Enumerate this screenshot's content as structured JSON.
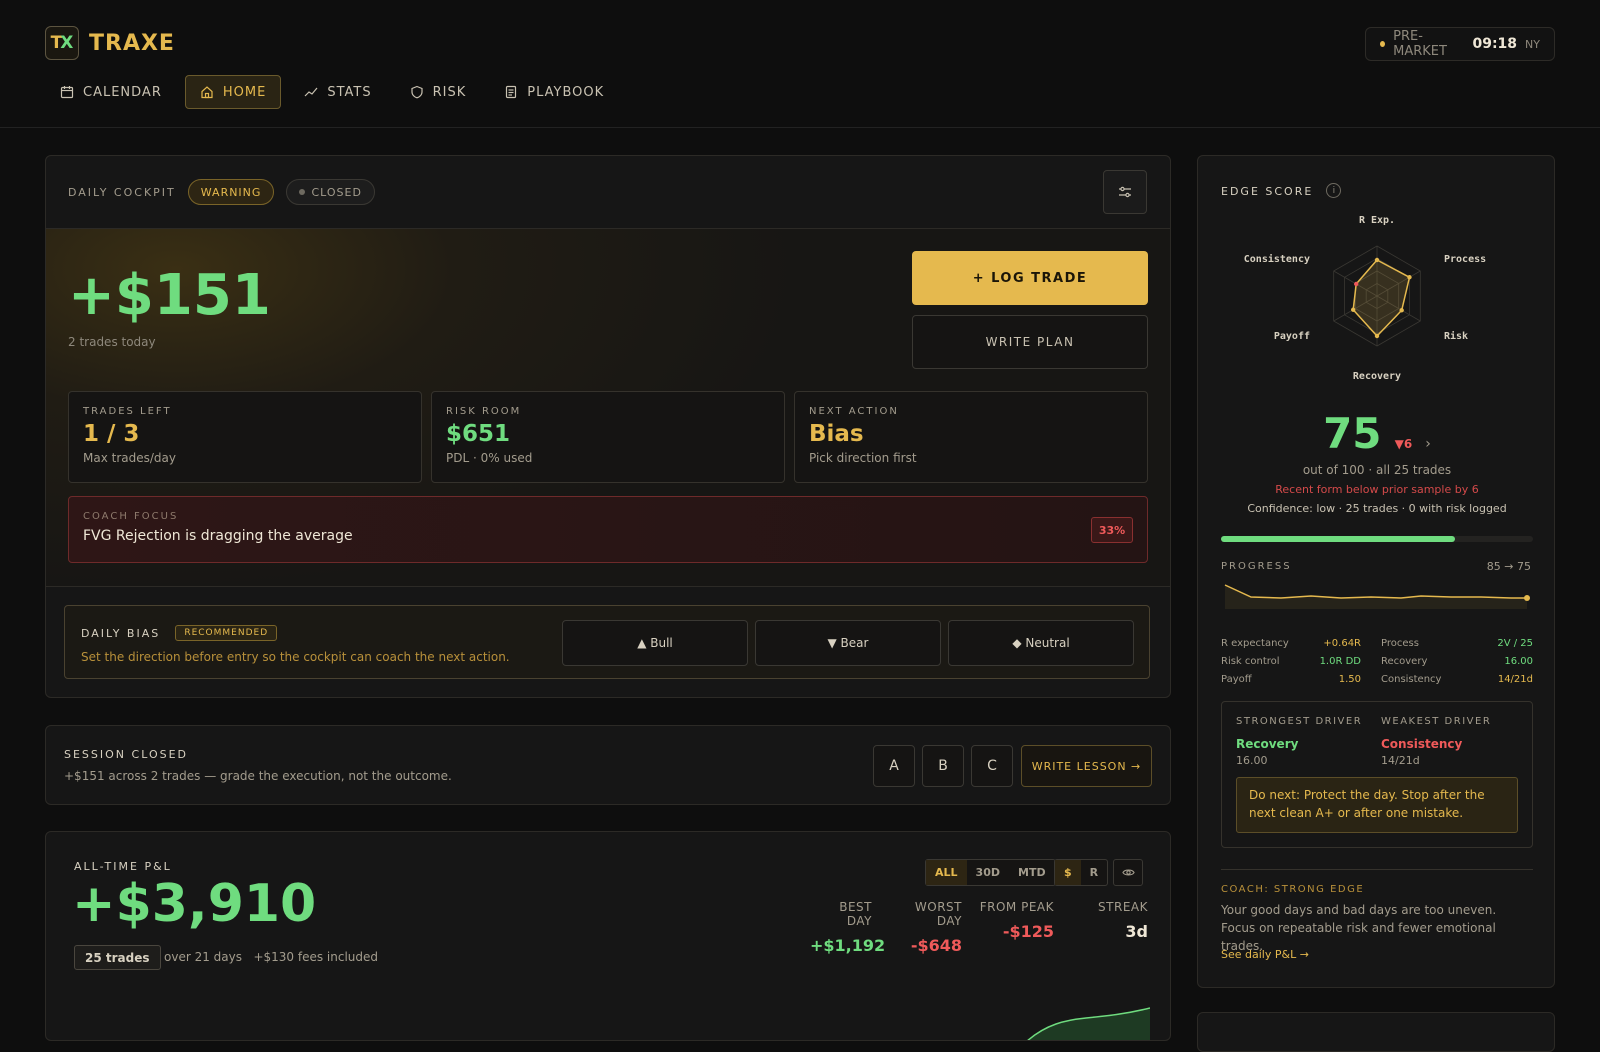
{
  "app": {
    "logo_mark_t": "T",
    "logo_mark_x": "X",
    "name": "TRAXE"
  },
  "clock": {
    "session": "PRE-MARKET",
    "time": "09:18",
    "tz": "NY"
  },
  "nav": [
    {
      "label": "CALENDAR",
      "icon": "calendar-icon",
      "active": false
    },
    {
      "label": "HOME",
      "icon": "home-icon",
      "active": true
    },
    {
      "label": "STATS",
      "icon": "trend-icon",
      "active": false
    },
    {
      "label": "RISK",
      "icon": "shield-icon",
      "active": false
    },
    {
      "label": "PLAYBOOK",
      "icon": "document-icon",
      "active": false
    }
  ],
  "cockpit": {
    "title": "DAILY COCKPIT",
    "status_warning": "WARNING",
    "status_closed": "CLOSED",
    "pnl": "+$151",
    "pnl_sub": "2 trades today",
    "log_trade": "+ LOG TRADE",
    "write_plan": "WRITE PLAN",
    "cards": [
      {
        "label": "TRADES LEFT",
        "value": "1 / 3",
        "sub": "Max trades/day"
      },
      {
        "label": "RISK ROOM",
        "value": "$651",
        "sub": "PDL · 0% used"
      },
      {
        "label": "NEXT ACTION",
        "value": "Bias",
        "sub": "Pick direction first"
      }
    ],
    "coach": {
      "label": "COACH FOCUS",
      "text": "FVG Rejection is dragging the average",
      "badge": "33%"
    },
    "bias": {
      "title": "DAILY BIAS",
      "badge": "RECOMMENDED",
      "desc": "Set the direction before entry so the cockpit can coach the next action.",
      "bull": "▲ Bull",
      "bear": "▼ Bear",
      "neutral": "◆ Neutral"
    }
  },
  "session": {
    "title": "SESSION CLOSED",
    "text": "+$151 across 2 trades — grade the execution, not the outcome.",
    "grades": [
      "A",
      "B",
      "C"
    ],
    "lesson": "WRITE LESSON →"
  },
  "alltime": {
    "title": "ALL-TIME P&L",
    "value": "+$3,910",
    "trades": "25 trades",
    "days": "over 21 days",
    "fees": "+$130 fees included",
    "ranges": [
      "ALL",
      "30D",
      "MTD"
    ],
    "units": [
      "$",
      "R"
    ],
    "kpis": [
      {
        "label": "BEST DAY",
        "value": "+$1,192",
        "color": "#6fdc7f"
      },
      {
        "label": "WORST DAY",
        "value": "-$648",
        "color": "#ef5a5a"
      },
      {
        "label": "FROM PEAK",
        "value": "-$125",
        "color": "#ef5a5a"
      },
      {
        "label": "STREAK",
        "value": "3d",
        "color": "#efe7d6"
      }
    ]
  },
  "edge": {
    "title": "EDGE SCORE",
    "info": "i",
    "axes": {
      "r_exp": "R Exp.",
      "process": "Process",
      "risk": "Risk",
      "recovery": "Recovery",
      "payoff": "Payoff",
      "consistency": "Consistency"
    },
    "axis_levels": [
      0.72,
      0.75,
      0.57,
      0.8,
      0.55,
      0.48
    ],
    "score": "75",
    "delta": "▼6",
    "out_of": "out of 100 · all 25 trades",
    "form_note": "Recent form below prior sample by 6",
    "confidence": "Confidence: low · 25 trades · 0 with risk logged",
    "progress_pct": 75,
    "progress_label": "PROGRESS",
    "progress_change": "85 → 75",
    "metrics": [
      {
        "name": "R expectancy",
        "value": "+0.64R",
        "name2": "Process",
        "value2": "2V / 25"
      },
      {
        "name": "Risk control",
        "value": "1.0R DD",
        "name2": "Recovery",
        "value2": "16.00"
      },
      {
        "name": "Payoff",
        "value": "1.50",
        "name2": "Consistency",
        "value2": "14/21d"
      }
    ],
    "strongest": {
      "label": "STRONGEST DRIVER",
      "name": "Recovery",
      "value": "16.00"
    },
    "weakest": {
      "label": "WEAKEST DRIVER",
      "name": "Consistency",
      "value": "14/21d"
    },
    "do_next": "Do next: Protect the day. Stop after the next clean A+ or after one mistake.",
    "coach_label": "COACH: STRONG EDGE",
    "coach_text": "Your good days and bad days are too uneven. Focus on repeatable risk and fewer emotional trades.",
    "coach_link": "See daily P&L →"
  }
}
